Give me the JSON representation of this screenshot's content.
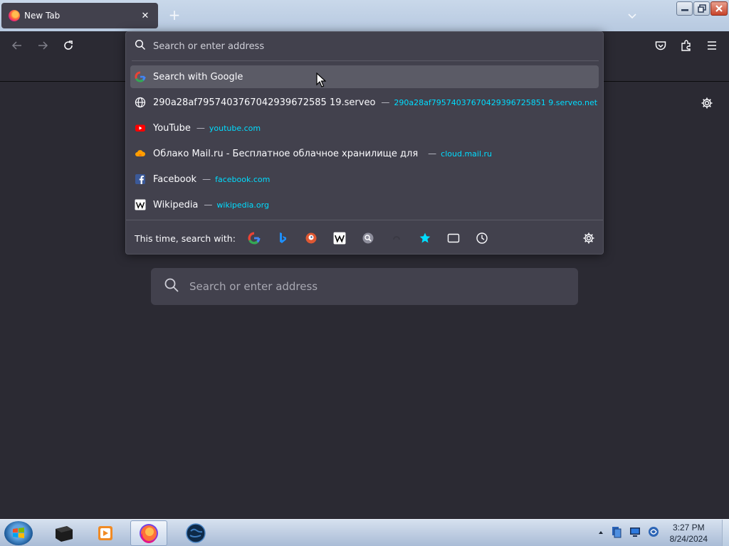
{
  "tab": {
    "title": "New Tab",
    "close": "✕"
  },
  "toolbar": {
    "new_tab": "+"
  },
  "urlbar": {
    "placeholder": "Search or enter address",
    "results": [
      {
        "icon": "google-icon",
        "title": "Search with Google",
        "url": ""
      },
      {
        "icon": "globe-icon",
        "title": "290a28af7957403767042939672585 19.serveo",
        "url": "290a28af79574037670429396725851 9.serveo.net"
      },
      {
        "icon": "youtube-icon",
        "title": "YouTube",
        "url": "youtube.com"
      },
      {
        "icon": "cloud-mail-icon",
        "title": "Облако Mail.ru - Бесплатное облачное хранилище для",
        "url": "cloud.mail.ru"
      },
      {
        "icon": "facebook-icon",
        "title": "Facebook",
        "url": "facebook.com"
      },
      {
        "icon": "wikipedia-icon",
        "title": "Wikipedia",
        "url": "wikipedia.org"
      }
    ],
    "dash": "—",
    "oneoff_label": "This time, search with:",
    "engines": [
      "google-icon",
      "bing-icon",
      "duckduckgo-icon",
      "wikipedia-icon",
      "search-engine-icon",
      "ebay-icon",
      "bookmarks-icon",
      "tabs-icon",
      "history-icon"
    ]
  },
  "content": {
    "search_placeholder": "Search or enter address"
  },
  "clock": {
    "time": "3:27 PM",
    "date": "8/24/2024"
  },
  "colors": {
    "accent_url": "#00ddff",
    "panel": "#42414d",
    "background": "#2b2a33"
  }
}
